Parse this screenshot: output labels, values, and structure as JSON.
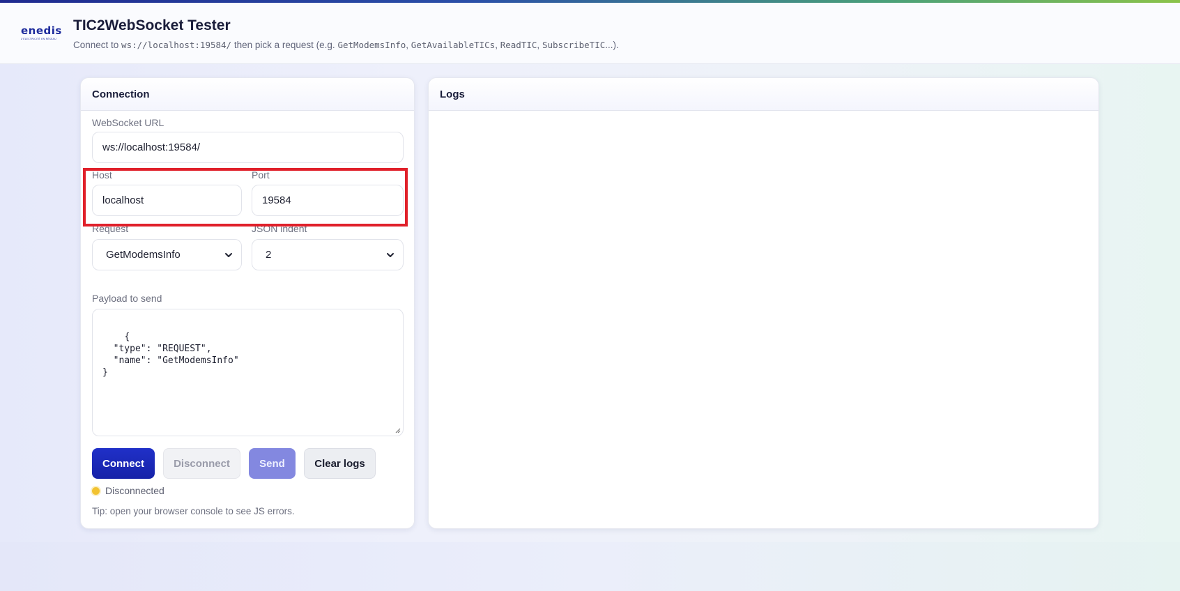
{
  "header": {
    "logo_text": "enedis",
    "logo_subtext": "L'ÉLECTRICITÉ EN RÉSEAU",
    "title": "TIC2WebSocket Tester",
    "subtitle": {
      "prefix": "Connect to ",
      "url": "ws://localhost:19584/",
      "middle": " then pick a request (e.g. ",
      "example1": "GetModemsInfo",
      "sep1": ", ",
      "example2": "GetAvailableTICs",
      "sep2": ", ",
      "example3": "ReadTIC",
      "sep3": ", ",
      "example4": "SubscribeTIC",
      "suffix": "...)."
    }
  },
  "connection": {
    "title": "Connection",
    "ws_url_label": "WebSocket URL",
    "ws_url_value": "ws://localhost:19584/",
    "host_label": "Host",
    "host_value": "localhost",
    "port_label": "Port",
    "port_value": "19584",
    "request_label": "Request",
    "request_value": "GetModemsInfo",
    "indent_label": "JSON indent",
    "indent_value": "2",
    "payload_label": "Payload to send",
    "payload_value": "{\n  \"type\": \"REQUEST\",\n  \"name\": \"GetModemsInfo\"\n}",
    "buttons": {
      "connect": "Connect",
      "disconnect": "Disconnect",
      "send": "Send",
      "clear_logs": "Clear logs"
    },
    "status_text": "Disconnected",
    "status_color": "#f2c230",
    "tip": "Tip: open your browser console to see JS errors."
  },
  "logs": {
    "title": "Logs"
  },
  "colors": {
    "accent": "#1c2a9c",
    "connect_button": "#1a26b8",
    "send_button": "#8388e0",
    "highlight_box": "#e0202a"
  }
}
